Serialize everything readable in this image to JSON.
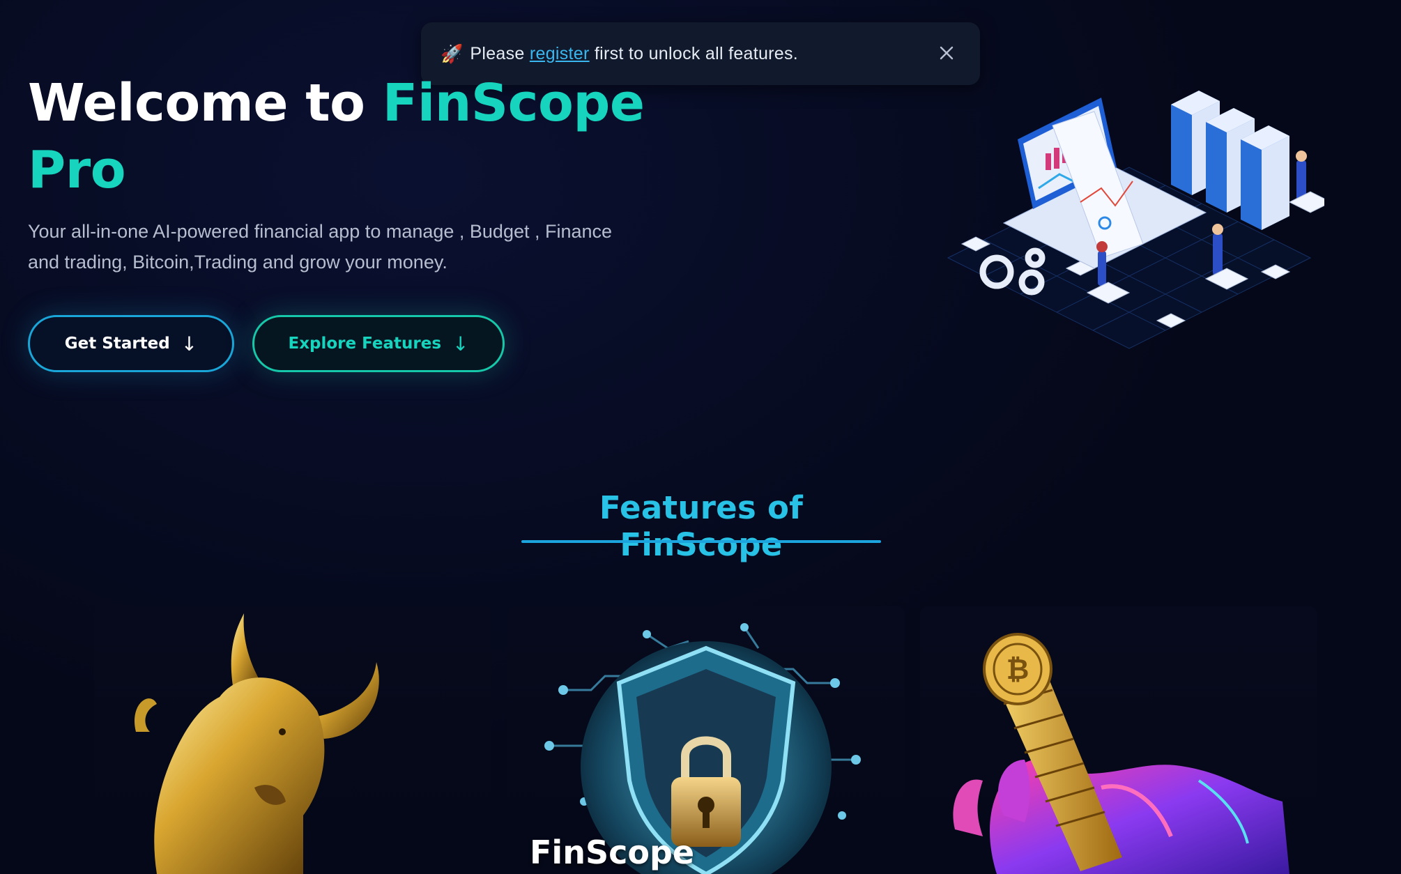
{
  "toast": {
    "icon": "rocket-icon",
    "before": "Please ",
    "link": "register",
    "after": " first to unlock all features.",
    "close_icon": "close-icon"
  },
  "hero": {
    "title_white": "Welcome to ",
    "title_accent_1": "FinScope",
    "title_accent_2": "Pro",
    "subtitle": "Your all-in-one AI-powered financial app to manage , Budget , Finance and trading, Bitcoin,Trading and grow your money.",
    "buttons": {
      "get_started": "Get Started",
      "explore": "Explore Features"
    },
    "arrow": "↓",
    "accent_color": "#17d4bf"
  },
  "features": {
    "heading": "Features of FinScope",
    "heading_color": "#28c2e6",
    "cards": [
      {
        "image": "golden-bull-image"
      },
      {
        "image": "security-shield-lock-image",
        "caption": "FinScope"
      },
      {
        "image": "bitcoin-stack-hand-image"
      }
    ]
  }
}
